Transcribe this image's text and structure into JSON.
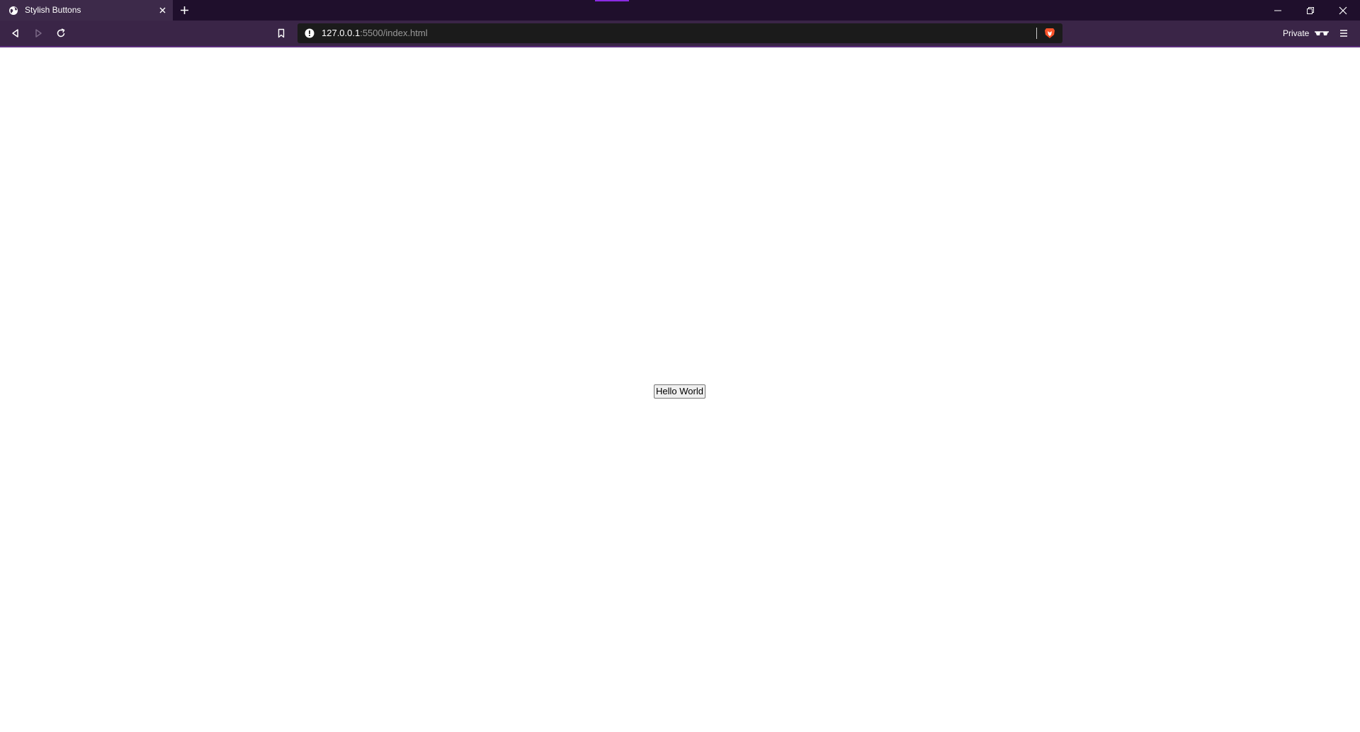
{
  "browser": {
    "tab": {
      "title": "Stylish Buttons",
      "favicon": "globe-icon"
    },
    "address_bar": {
      "host": "127.0.0.1",
      "path": ":5500/index.html",
      "security_icon": "info-warning-icon",
      "shield_icon": "brave-lion-icon"
    },
    "private_label": "Private",
    "colors": {
      "tabstrip": "#1f0f2c",
      "toolbar": "#3a2547",
      "active_tab": "#3d2a4a",
      "accent": "#8a2be2",
      "brave_orange": "#fb542b"
    }
  },
  "page": {
    "button_label": "Hello World"
  }
}
